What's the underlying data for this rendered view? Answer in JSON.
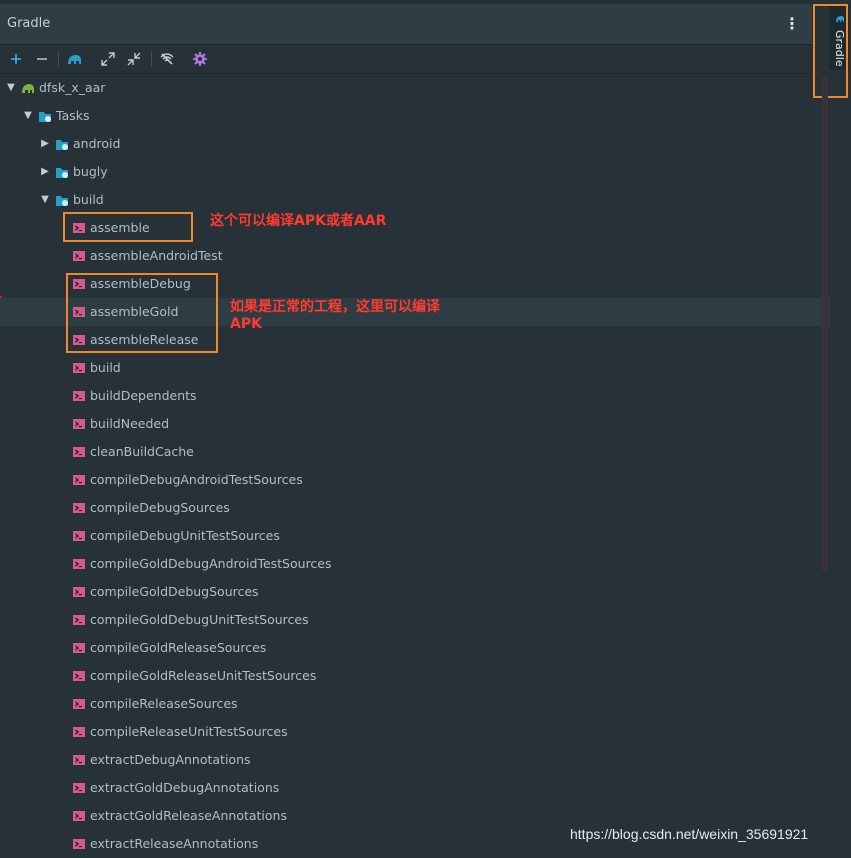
{
  "panel": {
    "title": "Gradle"
  },
  "stripe": {
    "tab_label": "Gradle"
  },
  "toolbar": {
    "buttons": [
      {
        "name": "add-icon",
        "glyph": "+"
      },
      {
        "name": "remove-icon",
        "glyph": "−"
      },
      {
        "name": "elephant-icon"
      },
      {
        "name": "expand-all-icon"
      },
      {
        "name": "collapse-all-icon"
      },
      {
        "name": "toggle-offline-icon"
      },
      {
        "name": "gear-icon"
      }
    ]
  },
  "colors": {
    "bg": "#263238",
    "task_icon": "#d35a8e",
    "folder_icon": "#26a0c8",
    "gradle_green": "#7cb342",
    "annotation_orange": "#f0892c",
    "annotation_red": "#ff3b30"
  },
  "tree": {
    "project": "dfsk_x_aar",
    "tasks": "Tasks",
    "groups": [
      "android",
      "bugly",
      "build"
    ],
    "build_tasks": [
      "assemble",
      "assembleAndroidTest",
      "assembleDebug",
      "assembleGold",
      "assembleRelease",
      "build",
      "buildDependents",
      "buildNeeded",
      "cleanBuildCache",
      "compileDebugAndroidTestSources",
      "compileDebugSources",
      "compileDebugUnitTestSources",
      "compileGoldDebugAndroidTestSources",
      "compileGoldDebugSources",
      "compileGoldDebugUnitTestSources",
      "compileGoldReleaseSources",
      "compileGoldReleaseUnitTestSources",
      "compileReleaseSources",
      "compileReleaseUnitTestSources",
      "extractDebugAnnotations",
      "extractGoldDebugAnnotations",
      "extractGoldReleaseAnnotations",
      "extractReleaseAnnotations"
    ]
  },
  "annotations": {
    "note1": "这个可以编译APK或者AAR",
    "note2_line1": "如果是正常的工程，这里可以编译",
    "note2_line2": "APK"
  },
  "watermark": "https://blog.csdn.net/weixin_35691921"
}
